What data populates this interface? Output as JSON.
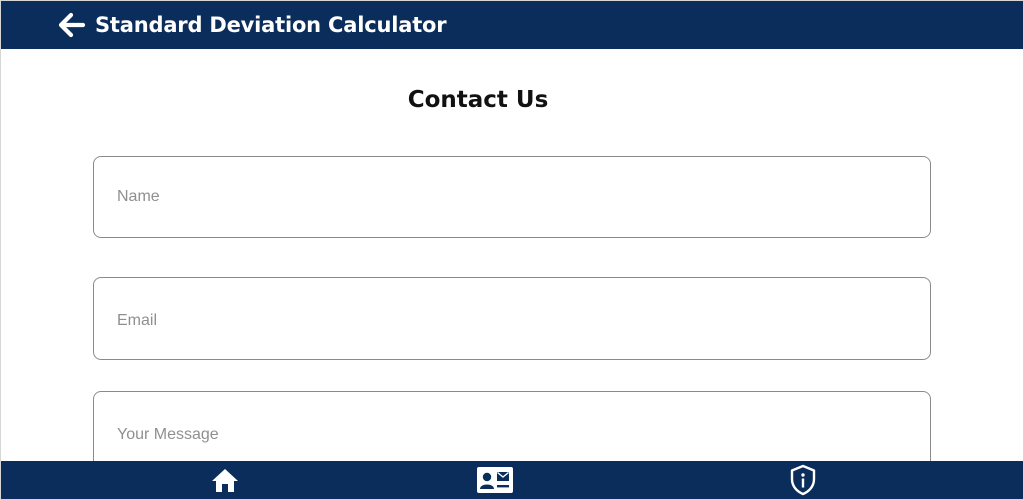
{
  "app_bar": {
    "title": "Standard Deviation Calculator",
    "back_icon": "arrow-left-icon",
    "color": "#0b2d5c"
  },
  "page": {
    "title": "Contact Us"
  },
  "form": {
    "name_placeholder": "Name",
    "name_value": "",
    "email_placeholder": "Email",
    "email_value": "",
    "message_placeholder": "Your Message",
    "message_value": ""
  },
  "bottom_nav": {
    "items": [
      {
        "id": "home",
        "icon": "home-icon"
      },
      {
        "id": "contact",
        "icon": "contact-card-icon"
      },
      {
        "id": "about",
        "icon": "shield-info-icon"
      }
    ],
    "color": "#0b2d5c"
  }
}
